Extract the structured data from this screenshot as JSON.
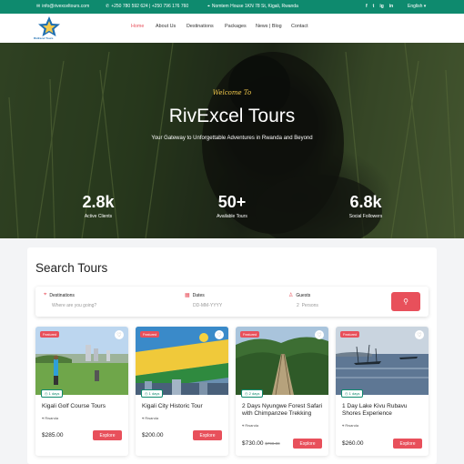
{
  "topbar": {
    "email": "info@rivexceltours.com",
    "phone": "+250 780 592 624 | +250 796 176 760",
    "address": "Nomtem House 1KN 78 St, Kigali, Rwanda",
    "social": [
      "f",
      "t",
      "ig",
      "in"
    ],
    "language": "English ▾"
  },
  "nav": {
    "logo_text": "RivExcel Tours",
    "items": [
      "Home",
      "About Us",
      "Destinations",
      "Packages",
      "News | Blog",
      "Contact"
    ],
    "active": "Home"
  },
  "hero": {
    "welcome": "Welcome To",
    "title": "RivExcel Tours",
    "subtitle": "Your Gateway to Unforgettable Adventures in Rwanda and Beyond",
    "stats": [
      {
        "value": "2.8k",
        "label": "Active Clients"
      },
      {
        "value": "50+",
        "label": "Available Tours"
      },
      {
        "value": "6.8k",
        "label": "Social Followers"
      }
    ]
  },
  "search": {
    "heading": "Search Tours",
    "destinations_label": "Destinations",
    "destinations_placeholder": "Where are you going?",
    "dates_label": "Dates",
    "dates_placeholder": "DD-MM-YYYY",
    "guests_label": "Guests",
    "guests_value": "2",
    "guests_unit": "Persons"
  },
  "tours": [
    {
      "badge": "Featured",
      "duration": "1 days",
      "name": "Kigali Golf Course Tours",
      "location": "Rwanda",
      "price": "$285.00",
      "old_price": "",
      "cta": "Explore"
    },
    {
      "badge": "Featured",
      "duration": "1 days",
      "name": "Kigali City Historic Tour",
      "location": "Rwanda",
      "price": "$200.00",
      "old_price": "",
      "cta": "Explore"
    },
    {
      "badge": "Featured",
      "duration": "2 days",
      "name": "2 Days Nyungwe Forest Safari with Chimpanzee Trekking",
      "location": "Rwanda",
      "price": "$730.00",
      "old_price": "$790.00",
      "cta": "Explore"
    },
    {
      "badge": "Featured",
      "duration": "1 days",
      "name": "1 Day Lake Kivu Rubavu Shores Experience",
      "location": "Rwanda",
      "price": "$260.00",
      "old_price": "",
      "cta": "Explore"
    }
  ],
  "colors": {
    "brand_green": "#0e8a6e",
    "accent_red": "#e8505b"
  }
}
